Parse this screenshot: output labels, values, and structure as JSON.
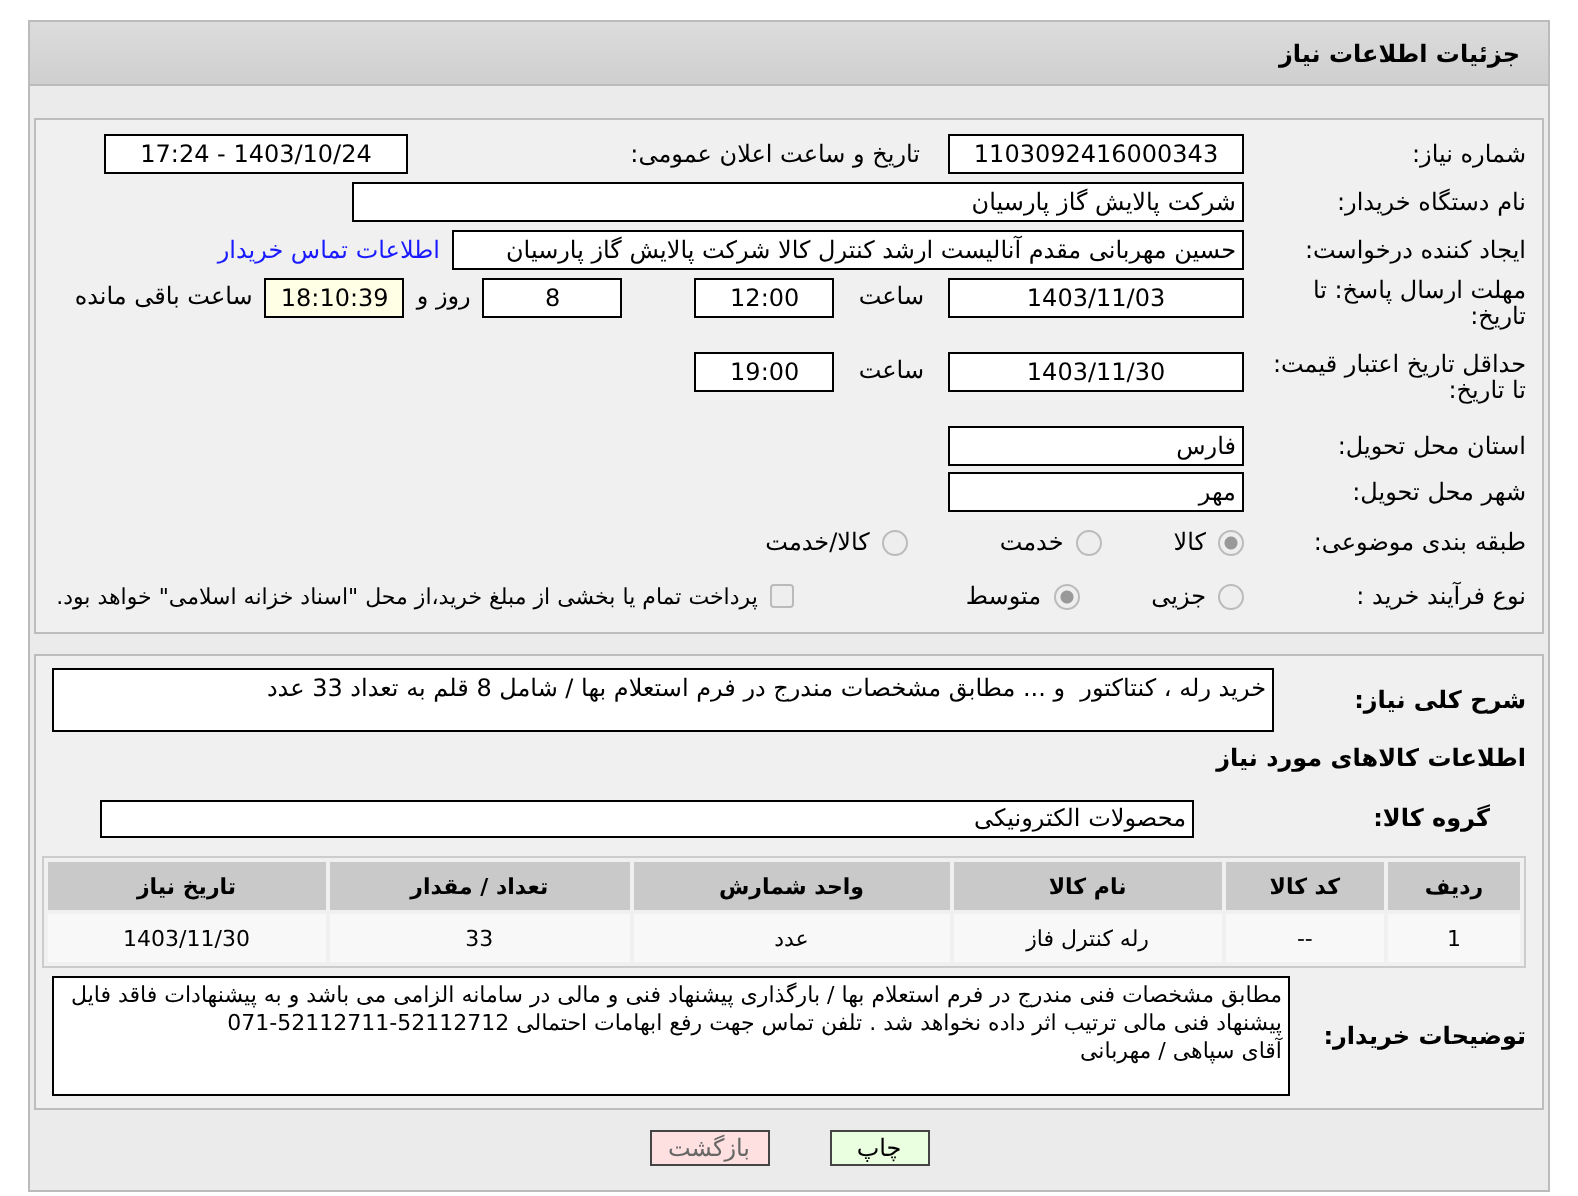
{
  "header": {
    "title": "جزئیات اطلاعات نیاز"
  },
  "details": {
    "need_number": {
      "label": "شماره نیاز:",
      "value": "1103092416000343"
    },
    "announce": {
      "label": "تاریخ و ساعت اعلان عمومی:",
      "value": "1403/10/24 - 17:24"
    },
    "buyer": {
      "label": "نام دستگاه خریدار:",
      "value": "شرکت پالایش گاز پارسیان"
    },
    "requester": {
      "label": "ایجاد کننده درخواست:",
      "value": "حسین مهربانی مقدم آنالیست ارشد کنترل کالا  شرکت پالایش گاز پارسیان",
      "link": "اطلاعات تماس خریدار"
    },
    "deadline": {
      "label": "مهلت ارسال پاسخ: تا تاریخ:",
      "date": "1403/11/03",
      "time_label": "ساعت",
      "time": "12:00",
      "days": "8",
      "days_label": "روز و",
      "remaining": "18:10:39",
      "remaining_label": "ساعت باقی مانده"
    },
    "validity": {
      "label": "حداقل تاریخ اعتبار قیمت: تا تاریخ:",
      "date": "1403/11/30",
      "time_label": "ساعت",
      "time": "19:00"
    },
    "province": {
      "label": "استان محل تحویل:",
      "value": "فارس"
    },
    "city": {
      "label": "شهر محل تحویل:",
      "value": "مهر"
    },
    "category": {
      "label": "طبقه بندی موضوعی:",
      "options": [
        {
          "label": "کالا",
          "selected": true
        },
        {
          "label": "خدمت",
          "selected": false
        },
        {
          "label": "کالا/خدمت",
          "selected": false
        }
      ]
    },
    "process": {
      "label": "نوع فرآیند خرید :",
      "options": [
        {
          "label": "جزیی",
          "selected": false
        },
        {
          "label": "متوسط",
          "selected": true
        }
      ],
      "payment": {
        "checked": false,
        "label": "پرداخت تمام یا بخشی از مبلغ خرید،از محل \"اسناد خزانه اسلامی\" خواهد بود."
      }
    }
  },
  "summary": {
    "label": "شرح کلی نیاز:",
    "value": "خرید رله ، کنتاکتور  و ... مطابق مشخصات مندرج در فرم استعلام بها / شامل 8 قلم به تعداد 33 عدد"
  },
  "items_section": {
    "title": "اطلاعات کالاهای مورد نیاز",
    "group": {
      "label": "گروه کالا:",
      "value": "محصولات الکترونیکی"
    },
    "table": {
      "columns": [
        "ردیف",
        "کد کالا",
        "نام کالا",
        "واحد شمارش",
        "تعداد / مقدار",
        "تاریخ نیاز"
      ],
      "rows": [
        [
          "1",
          "--",
          "رله کنترل فاز",
          "عدد",
          "33",
          "1403/11/30"
        ]
      ]
    }
  },
  "buyer_notes": {
    "label": "توضیحات خریدار:",
    "value": "مطابق مشخصات فنی مندرج در فرم استعلام بها / بارگذاری پیشنهاد فنی و مالی در سامانه الزامی می باشد و به پیشنهادات فاقد فایل پیشنهاد فنی مالی ترتیب اثر داده نخواهد شد . تلفن تماس جهت رفع ابهامات احتمالی 52112712-52112711-071\nآقای سپاهی / مهربانی"
  },
  "buttons": [
    {
      "label": "چاپ",
      "kind": "print"
    },
    {
      "label": "بازگشت",
      "kind": "back"
    }
  ]
}
